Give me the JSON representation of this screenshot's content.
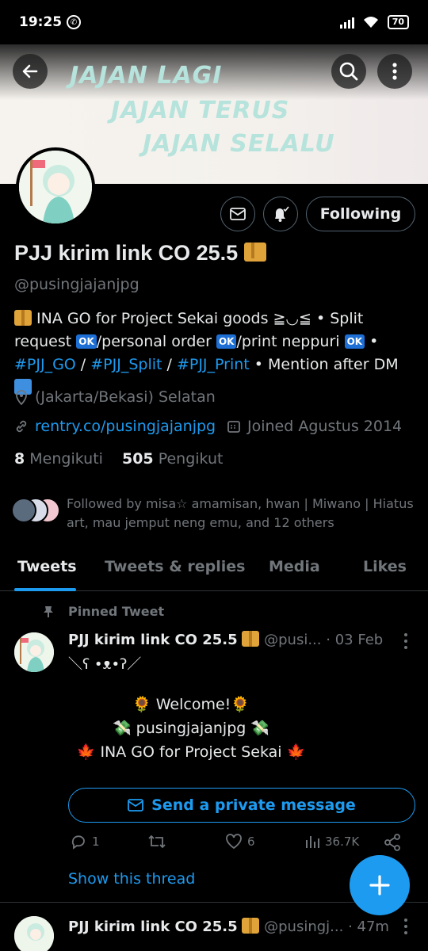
{
  "status_bar": {
    "time": "19:25",
    "battery": "70"
  },
  "banner": {
    "line1": "JAJAN LAGI",
    "line2": "JAJAN TERUS",
    "line3": "JAJAN SELALU"
  },
  "profile": {
    "name": "PJJ kirim link CO 25.5",
    "name_emoji": "package-icon",
    "handle": "@pusingjajanjpg",
    "follow_button": "Following",
    "bio": {
      "part1": " INA GO for Project Sekai goods ≧◡≦ • Split request ",
      "part2": "/personal order ",
      "part3": "/print neppuri ",
      "part4": " • ",
      "hashtag1": "#PJJ_GO",
      "part5": " / ",
      "hashtag2": "#PJJ_Split",
      "part6": " / ",
      "hashtag3": "#PJJ_Print",
      "part7": " • Mention after DM ",
      "ok_badge": "OK"
    },
    "location": "(Jakarta/Bekasi) Selatan",
    "website": "rentry.co/pusingjajanjpg",
    "joined": "Joined Agustus 2014",
    "following_count": "8",
    "following_label": "Mengikuti",
    "followers_count": "505",
    "followers_label": "Pengikut",
    "followed_by": "Followed by misa☆ amamisan, hwan | Miwano | Hiatus art, mau jemput neng emu, and 12 others"
  },
  "tabs": [
    "Tweets",
    "Tweets & replies",
    "Media",
    "Likes"
  ],
  "pinned_tweet": {
    "pinned_label": "Pinned Tweet",
    "author": "PJJ kirim link CO 25.5",
    "handle": "@pusi...",
    "date": "· 03 Feb",
    "kaomoji": "＼ʕ •ᴥ•ʔ／",
    "line1": "Welcome!",
    "line2": "pusingjajanjpg",
    "line3": "INA GO for Project Sekai",
    "dm_button": "Send a private message",
    "replies": "1",
    "retweets": "",
    "likes": "6",
    "views": "36.7K",
    "show_thread": "Show this thread"
  },
  "next_tweet": {
    "author": "PJJ kirim link CO 25.5",
    "handle": "@pusingj...",
    "time": "· 47m"
  },
  "colors": {
    "accent": "#1d9bf0",
    "background": "#000000",
    "text": "#e7e9ea",
    "muted": "#71767b"
  }
}
